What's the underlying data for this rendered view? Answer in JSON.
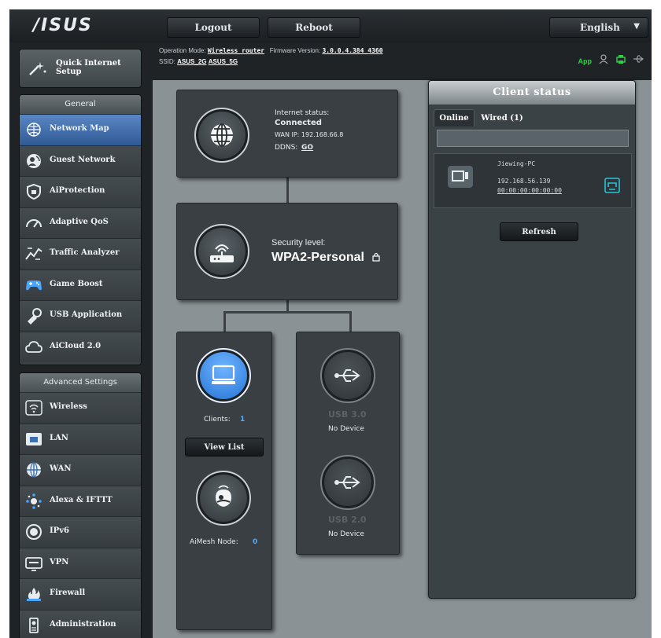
{
  "header": {
    "logo": "/ISUS",
    "logout_label": "Logout",
    "reboot_label": "Reboot",
    "language": "English"
  },
  "info": {
    "operation_mode_label": "Operation Mode:",
    "operation_mode_value": "Wireless router",
    "firmware_label": "Firmware Version:",
    "firmware_value": "3.0.0.4.384_4360",
    "ssid_label": "SSID:",
    "ssid_2g": "ASUS_2G",
    "ssid_5g": "ASUS_5G",
    "app_label": "App"
  },
  "sidebar": {
    "quick_setup_label": "Quick Internet Setup",
    "general_header": "General",
    "general_items": [
      {
        "label": "Network Map",
        "icon": "network-map-icon"
      },
      {
        "label": "Guest Network",
        "icon": "guest-network-icon"
      },
      {
        "label": "AiProtection",
        "icon": "shield-icon"
      },
      {
        "label": "Adaptive QoS",
        "icon": "speedometer-icon"
      },
      {
        "label": "Traffic Analyzer",
        "icon": "traffic-analyzer-icon"
      },
      {
        "label": "Game Boost",
        "icon": "gamepad-icon"
      },
      {
        "label": "USB Application",
        "icon": "usb-application-icon"
      },
      {
        "label": "AiCloud 2.0",
        "icon": "cloud-icon"
      }
    ],
    "advanced_header": "Advanced Settings",
    "advanced_items": [
      {
        "label": "Wireless",
        "icon": "wireless-icon"
      },
      {
        "label": "LAN",
        "icon": "lan-icon"
      },
      {
        "label": "WAN",
        "icon": "wan-globe-icon"
      },
      {
        "label": "Alexa & IFTTT",
        "icon": "alexa-icon"
      },
      {
        "label": "IPv6",
        "icon": "ipv6-icon"
      },
      {
        "label": "VPN",
        "icon": "vpn-icon"
      },
      {
        "label": "Firewall",
        "icon": "firewall-icon"
      },
      {
        "label": "Administration",
        "icon": "administration-icon"
      }
    ]
  },
  "map": {
    "internet_status_label": "Internet status:",
    "internet_status_value": "Connected",
    "wan_ip": "WAN IP: 192.168.66.8",
    "ddns_label": "DDNS:",
    "ddns_value": "GO",
    "security_level_label": "Security level:",
    "security_level_value": "WPA2-Personal",
    "clients_label": "Clients:",
    "clients_count": "1",
    "view_list_label": "View List",
    "aimesh_label": "AiMesh Node:",
    "aimesh_count": "0",
    "usb1_label": "USB 3.0",
    "usb1_status": "No Device",
    "usb2_label": "USB 2.0",
    "usb2_status": "No Device"
  },
  "client_status": {
    "title": "Client status",
    "tab_online": "Online",
    "tab_wired": "Wired (1)",
    "client_name": "Jiewing-PC",
    "client_ip": "192.168.56.139",
    "client_mac": "00:00:00:00:00:00",
    "refresh_label": "Refresh"
  },
  "colors": {
    "accent_blue": "#2f5a94",
    "app_green": "#2fcf48",
    "client_count_blue": "#5aa8ff",
    "panel_dark": "#393f42"
  }
}
